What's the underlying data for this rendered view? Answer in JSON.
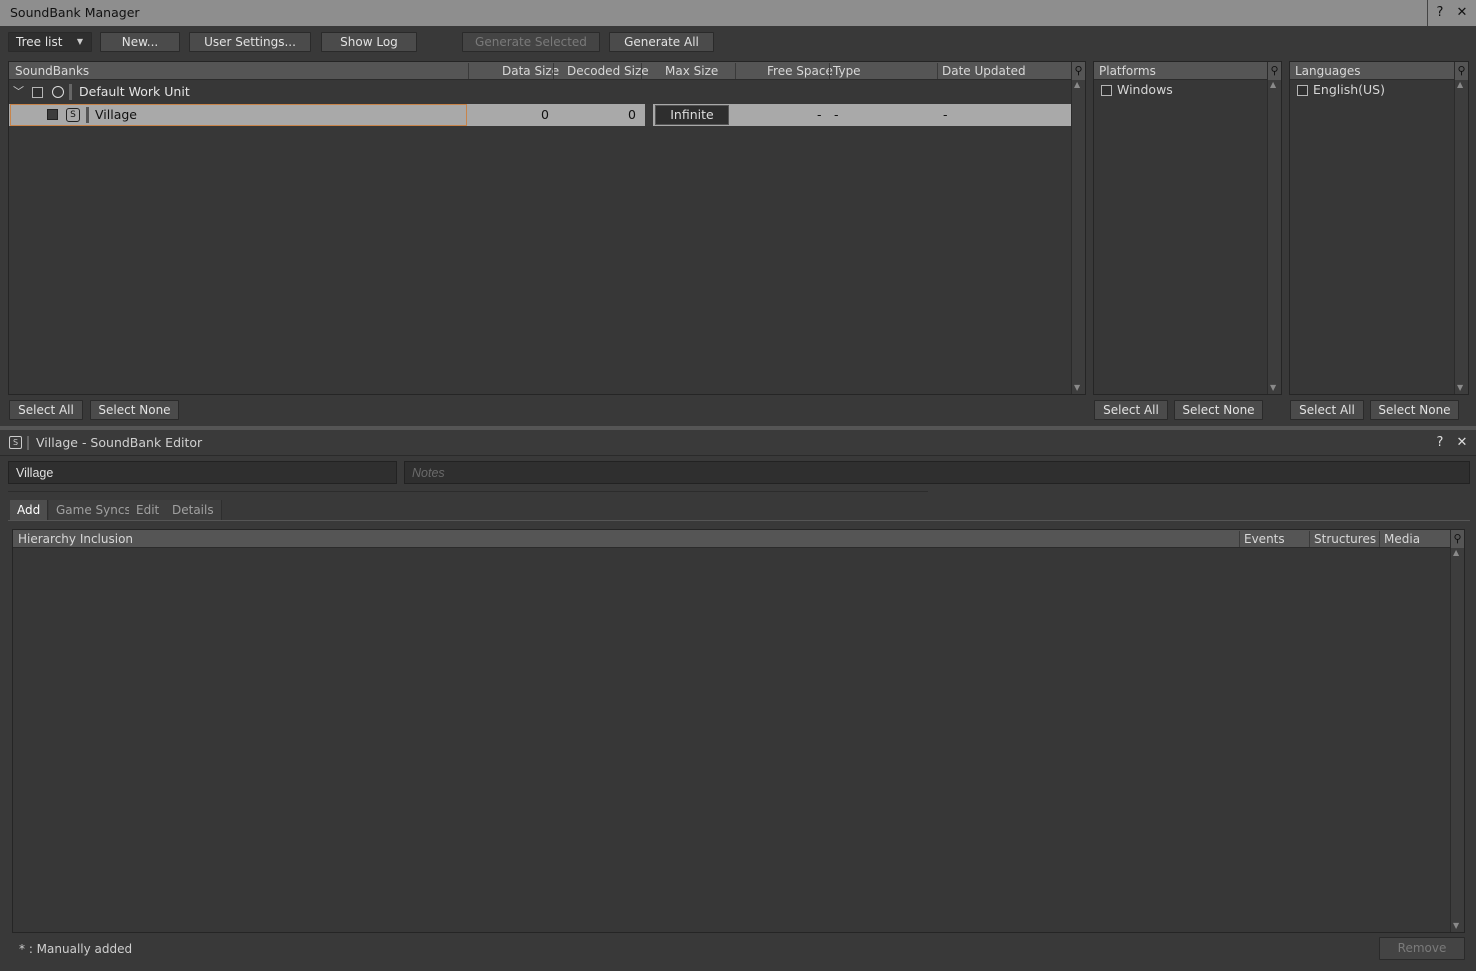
{
  "manager": {
    "title": "SoundBank Manager",
    "help_glyph": "?",
    "close_glyph": "✕",
    "view_select": "Tree list",
    "buttons": {
      "new": "New...",
      "user_settings": "User Settings...",
      "show_log": "Show Log",
      "generate_selected": "Generate Selected",
      "generate_all": "Generate All"
    },
    "soundbanks": {
      "columns": [
        "SoundBanks",
        "Data Size",
        "Decoded Size",
        "Max Size",
        "Free Space",
        "Type",
        "Date Updated"
      ],
      "work_unit": "Default Work Unit",
      "rows": [
        {
          "name": "Village",
          "data_size": "0",
          "decoded_size": "0",
          "max_size": "Infinite",
          "free_space": "-",
          "type": "-",
          "date_updated": "-"
        }
      ],
      "select_all": "Select All",
      "select_none": "Select None"
    },
    "platforms": {
      "header": "Platforms",
      "items": [
        "Windows"
      ],
      "select_all": "Select All",
      "select_none": "Select None"
    },
    "languages": {
      "header": "Languages",
      "items": [
        "English(US)"
      ],
      "select_all": "Select All",
      "select_none": "Select None"
    }
  },
  "editor": {
    "title": "Village - SoundBank Editor",
    "help_glyph": "?",
    "close_glyph": "✕",
    "name_value": "Village",
    "notes_placeholder": "Notes",
    "tabs": [
      "Add",
      "Game Syncs",
      "Edit",
      "Details"
    ],
    "columns": [
      "Hierarchy Inclusion",
      "Events",
      "Structures",
      "Media"
    ],
    "footer_note": "* : Manually added",
    "remove": "Remove"
  },
  "colors": {
    "selected_row": "#a9a9a9",
    "title_bar": "#8e8e8e",
    "background": "#393939"
  }
}
